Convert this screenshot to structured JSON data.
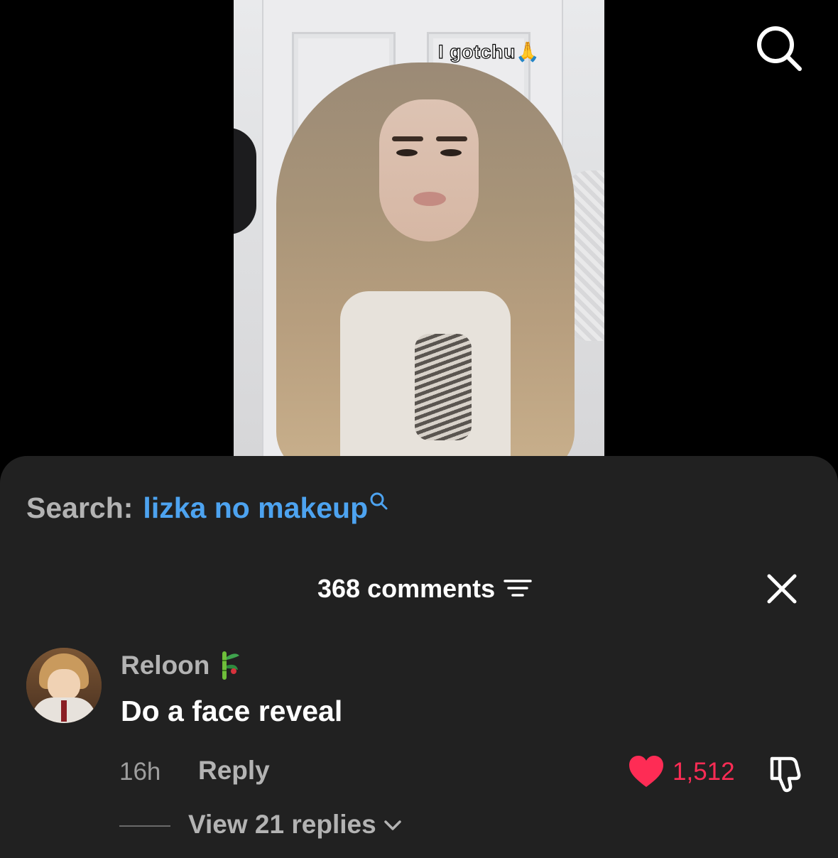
{
  "video": {
    "caption_text": "I gotchu",
    "caption_emoji": "🙏"
  },
  "search_bar": {
    "label": "Search:",
    "query": "lizka no makeup"
  },
  "comments_header": {
    "count_label": "368 comments"
  },
  "comment": {
    "username": "Reloon",
    "badge": "🎋",
    "text": "Do a face reveal",
    "timestamp": "16h",
    "reply_label": "Reply",
    "like_count": "1,512",
    "view_replies_label": "View 21 replies"
  },
  "colors": {
    "accent_blue": "#4da3f0",
    "like_red": "#fe2c55",
    "sheet_bg": "#212121"
  },
  "icons": [
    "search-icon",
    "search-mini-icon",
    "filter-icon",
    "close-icon",
    "heart-icon",
    "dislike-icon",
    "chevron-down-icon"
  ]
}
